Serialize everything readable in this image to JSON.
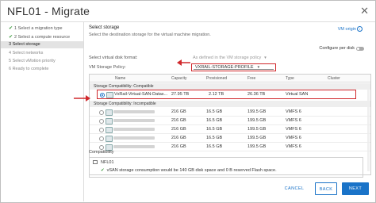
{
  "window": {
    "title": "NFL01 - Migrate",
    "close_glyph": "✕"
  },
  "steps": [
    {
      "label": "1 Select a migration type",
      "state": "done"
    },
    {
      "label": "2 Select a compute resource",
      "state": "done"
    },
    {
      "label": "3 Select storage",
      "state": "active"
    },
    {
      "label": "4 Select networks",
      "state": "pending"
    },
    {
      "label": "5 Select vMotion priority",
      "state": "pending"
    },
    {
      "label": "6 Ready to complete",
      "state": "pending"
    }
  ],
  "main": {
    "title": "Select storage",
    "subtitle": "Select the destination storage for the virtual machine migration.",
    "vm_origin": "VM origin",
    "configure_per_disk": "Configure per disk",
    "disk_format_label": "Select virtual disk format:",
    "disk_format_value": "As defined in the VM storage policy",
    "policy_label": "VM Storage Policy:",
    "policy_value": "VXRAIL-STORAGE-PROFILE"
  },
  "table": {
    "columns": [
      "Name",
      "Capacity",
      "Provisioned",
      "Free",
      "Type",
      "Cluster"
    ],
    "group_compatible": "Storage Compatibility: Compatible",
    "group_incompatible": "Storage Compatibility: Incompatible",
    "compatible_rows": [
      {
        "name": "VxRail-Virtual-SAN-Datas...",
        "capacity": "27.95 TB",
        "provisioned": "2.12 TB",
        "free": "26.36 TB",
        "type": "Virtual SAN"
      }
    ],
    "incompatible_rows": [
      {
        "capacity": "216 GB",
        "provisioned": "16.5 GB",
        "free": "199.5 GB",
        "type": "VMFS 6"
      },
      {
        "capacity": "216 GB",
        "provisioned": "16.5 GB",
        "free": "199.5 GB",
        "type": "VMFS 6"
      },
      {
        "capacity": "216 GB",
        "provisioned": "16.5 GB",
        "free": "199.5 GB",
        "type": "VMFS 6"
      },
      {
        "capacity": "216 GB",
        "provisioned": "16.5 GB",
        "free": "199.5 GB",
        "type": "VMFS 6"
      },
      {
        "capacity": "216 GB",
        "provisioned": "16.5 GB",
        "free": "199.5 GB",
        "type": "VMFS 6"
      }
    ]
  },
  "compatibility": {
    "title": "Compatibility",
    "host": "NFL01",
    "message": "vSAN storage consumption would be 140 GB disk space and 0 B reserved Flash space."
  },
  "buttons": {
    "cancel": "CANCEL",
    "back": "BACK",
    "next": "NEXT"
  },
  "colors": {
    "accent": "#1a73c8",
    "highlight": "#d0282c",
    "success": "#3c9a3c"
  }
}
